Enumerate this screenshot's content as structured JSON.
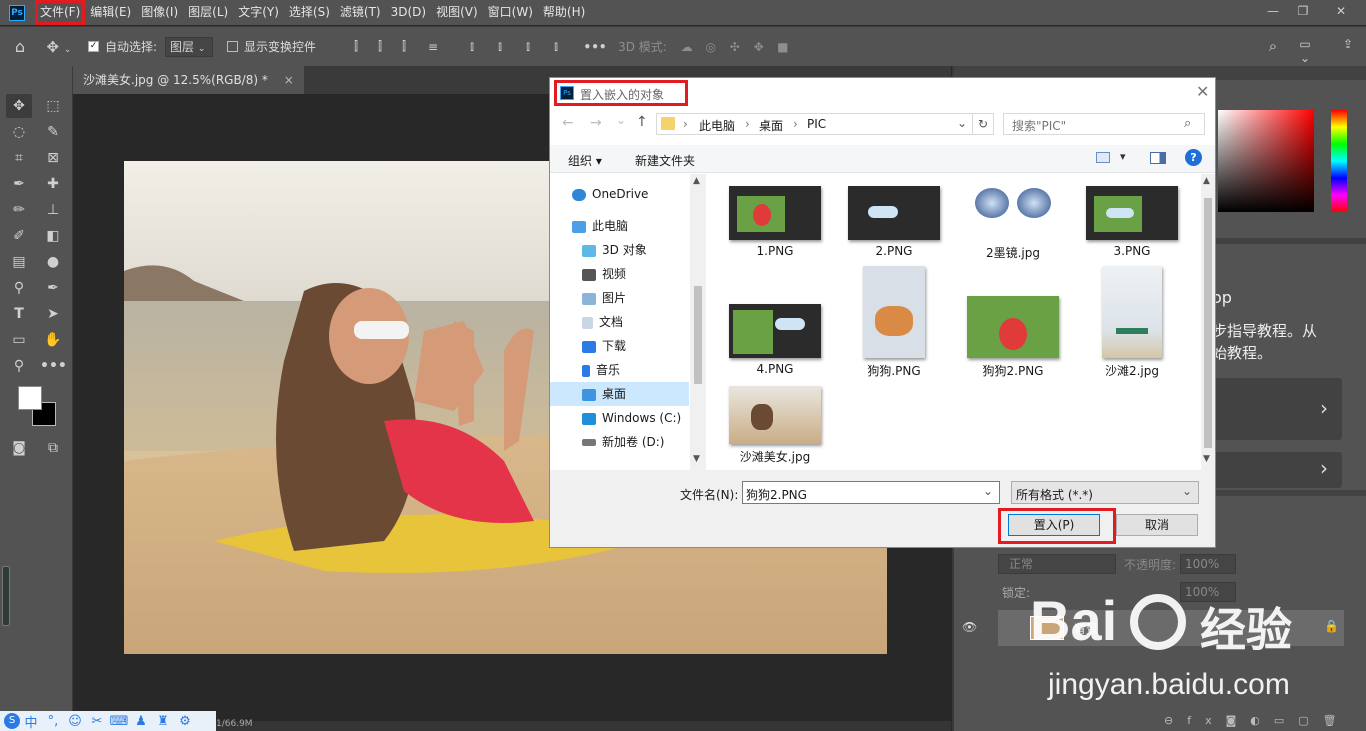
{
  "app": {
    "logo": "Ps"
  },
  "menu": [
    "文件(F)",
    "编辑(E)",
    "图像(I)",
    "图层(L)",
    "文字(Y)",
    "选择(S)",
    "滤镜(T)",
    "3D(D)",
    "视图(V)",
    "窗口(W)",
    "帮助(H)"
  ],
  "window_controls": {
    "minimize": "—",
    "restore": "❐",
    "close": "✕"
  },
  "options": {
    "auto_select_label": "自动选择:",
    "auto_select_value": "图层",
    "show_transform_label": "显示变换控件",
    "mode_3d_label": "3D 模式:",
    "more": "•••"
  },
  "doc_tab": {
    "title": "沙滩美女.jpg @ 12.5%(RGB/8) *",
    "close": "×"
  },
  "status": {
    "text": "1/66.9M"
  },
  "dialog": {
    "title": "置入嵌入的对象",
    "breadcrumb": [
      "此电脑",
      "桌面",
      "PIC"
    ],
    "search_placeholder": "搜索\"PIC\"",
    "organize_label": "组织 ▾",
    "new_folder_label": "新建文件夹",
    "nav": [
      "OneDrive",
      "此电脑",
      "3D 对象",
      "视频",
      "图片",
      "文档",
      "下载",
      "音乐",
      "桌面",
      "Windows (C:)",
      "新加卷 (D:)"
    ],
    "files": [
      "1.PNG",
      "2.PNG",
      "2墨镜.jpg",
      "3.PNG",
      "4.PNG",
      "狗狗.PNG",
      "狗狗2.PNG",
      "沙滩2.jpg",
      "沙滩美女.jpg"
    ],
    "filename_label": "文件名(N):",
    "filename_value": "狗狗2.PNG",
    "filetype_value": "所有格式 (*.*)",
    "place_button": "置入(P)",
    "cancel_button": "取消"
  },
  "right_panel": {
    "learn_title_fragment": "op",
    "learn_line1": "步指导教程。从",
    "learn_line2": "始教程。",
    "blend_mode": "正常",
    "opacity_label": "不透明度:",
    "opacity_value": "100%",
    "lock_label": "锁定:",
    "fill_value": "100%",
    "layer_name": "背景"
  },
  "watermark": {
    "brand": "Bai",
    "brand2": "经验",
    "url": "jingyan.baidu.com"
  },
  "colors": {
    "highlight": "#e21b23",
    "ps_blue": "#31a8ff",
    "panel": "#535353"
  }
}
